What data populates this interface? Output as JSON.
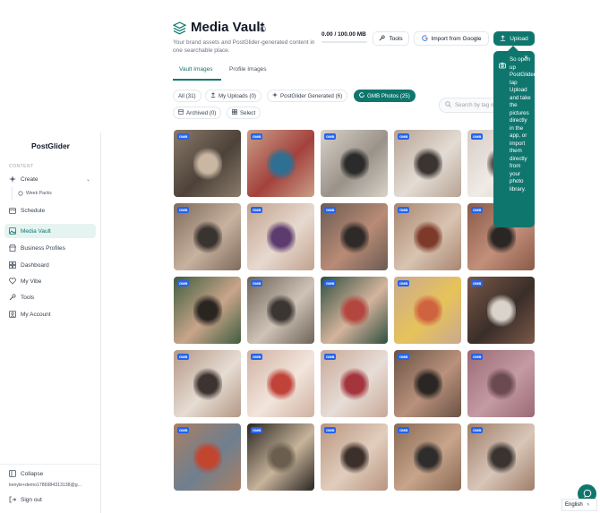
{
  "app": {
    "name": "PostGlider"
  },
  "sidebar": {
    "section_label": "CONTENT",
    "items": [
      {
        "label": "Create",
        "icon": "sparkle-icon"
      },
      {
        "label": "Week Packs",
        "icon": "circle-icon"
      },
      {
        "label": "Schedule",
        "icon": "calendar-icon"
      },
      {
        "label": "Media Vault",
        "icon": "image-icon"
      },
      {
        "label": "Business Profiles",
        "icon": "store-icon"
      },
      {
        "label": "Dashboard",
        "icon": "grid-icon"
      },
      {
        "label": "My Vibe",
        "icon": "heart-icon"
      },
      {
        "label": "Tools",
        "icon": "wrench-icon"
      },
      {
        "label": "My Account",
        "icon": "user-icon"
      }
    ],
    "collapse_label": "Collapse",
    "user_email": "kenyle+demo1786984313138@g...",
    "signout_label": "Sign out"
  },
  "header": {
    "title": "Media Vault",
    "subtitle": "Your brand assets and PostGlider-generated content in one searchable place.",
    "storage_text": "0.00 / 100.00 MB",
    "storage_used_fraction": 0.0,
    "tools_label": "Tools",
    "google_label": "Import from Google",
    "upload_label": "Upload"
  },
  "tabs": [
    {
      "label": "Vault Images",
      "active": true
    },
    {
      "label": "Profile Images",
      "active": false
    }
  ],
  "filters": {
    "chips": [
      {
        "label": "All (31)"
      },
      {
        "label": "My Uploads (0)"
      },
      {
        "label": "PostGlider Generated (6)"
      },
      {
        "label": "GMB Photos (25)",
        "active": true
      },
      {
        "label": "Archived (0)"
      },
      {
        "label": "Select"
      }
    ],
    "search_placeholder": "Search by tag or..."
  },
  "tooltip": {
    "text": "So open up PostGlider, tap Upload and take the pictures directly in the app, or import them directly from your photo library."
  },
  "grid": {
    "badge_label": "GMB",
    "tile_count": 25
  },
  "language": {
    "label": "English"
  },
  "colors": {
    "accent": "#0f766e",
    "badge": "#2563eb"
  }
}
